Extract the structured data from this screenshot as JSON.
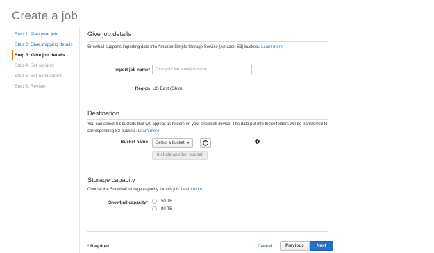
{
  "page": {
    "title": "Create a job"
  },
  "steps": [
    {
      "label": "Step 1: Plan your job",
      "state": "link"
    },
    {
      "label": "Step 2: Give shipping details",
      "state": "link"
    },
    {
      "label": "Step 3: Give job details",
      "state": "active"
    },
    {
      "label": "Step 4: Set security",
      "state": "disabled"
    },
    {
      "label": "Step 5: Set notifications",
      "state": "disabled"
    },
    {
      "label": "Step 6: Review",
      "state": "disabled"
    }
  ],
  "job_details": {
    "title": "Give job details",
    "description": "Snowball supports importing data into Amazon Simple Storage Service (Amazon S3) buckets.",
    "learn_more": "Learn more.",
    "import_job_name_label": "Import job name*",
    "import_job_name_placeholder": "Give your job a unique name",
    "import_job_name_value": "",
    "region_label": "Region",
    "region_value": "US East (Ohio)"
  },
  "destination": {
    "title": "Destination",
    "description": "You can select S3 buckets that will appear as folders on your snowball device. The data put into these folders will be transferred to corresponding S3 buckets.",
    "learn_more": "Learn more.",
    "bucket_label": "Bucket name",
    "bucket_select_value": "Select a bucket",
    "include_button": "Include another bucket"
  },
  "storage": {
    "title": "Storage capacity",
    "description": "Choose the Snowball storage capacity for this job.",
    "learn_more": "Learn more.",
    "capacity_label": "Snowball capacity*",
    "options": [
      "50 TB",
      "80 TB"
    ]
  },
  "footer": {
    "required_note": "* Required",
    "cancel": "Cancel",
    "previous": "Previous",
    "next": "Next"
  },
  "colors": {
    "accent": "#2272c3",
    "link": "#1f6fb2",
    "active_step_marker": "#e07b00"
  },
  "icons": {
    "refresh": "refresh-icon",
    "info": "info-icon",
    "dropdown": "caret-down-icon"
  }
}
